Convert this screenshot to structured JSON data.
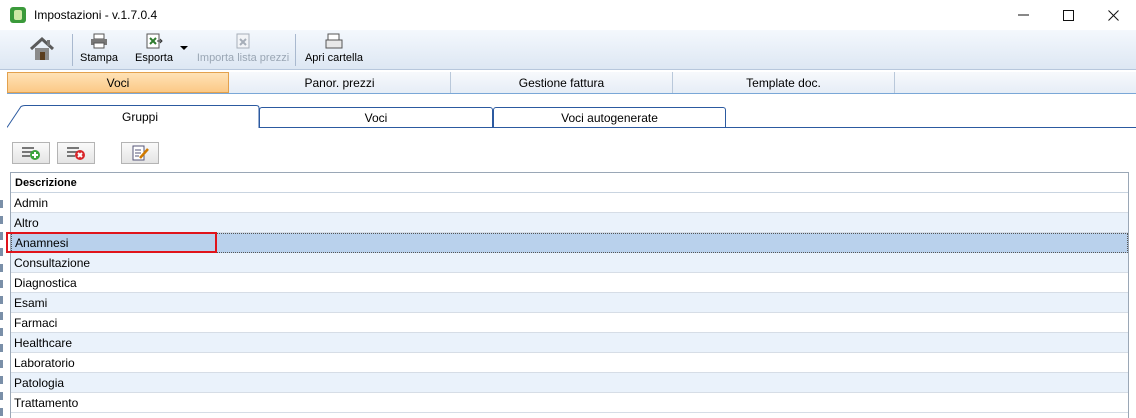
{
  "window": {
    "title": "Impostazioni  -  v.1.7.0.4",
    "controls": [
      "minimize",
      "maximize",
      "close"
    ]
  },
  "toolbar": {
    "home_icon": "home-icon",
    "stampa_label": "Stampa",
    "esporta_label": "Esporta",
    "importa_label": "Importa lista prezzi",
    "apri_label": "Apri cartella"
  },
  "main_tabs": [
    {
      "label": "Voci",
      "active": true
    },
    {
      "label": "Panor. prezzi",
      "active": false
    },
    {
      "label": "Gestione fattura",
      "active": false
    },
    {
      "label": "Template doc.",
      "active": false
    }
  ],
  "sub_tabs": [
    {
      "label": "Gruppi",
      "active": true
    },
    {
      "label": "Voci",
      "active": false
    },
    {
      "label": "Voci autogenerate",
      "active": false
    }
  ],
  "actions": [
    "add-icon",
    "delete-icon",
    "edit-icon"
  ],
  "grid": {
    "header": "Descrizione",
    "rows": [
      "Admin",
      "Altro",
      "Anamnesi",
      "Consultazione",
      "Diagnostica",
      "Esami",
      "Farmaci",
      "Healthcare",
      "Laboratorio",
      "Patologia",
      "Trattamento"
    ],
    "selected_index": 2
  },
  "colors": {
    "active_tab": "#fbc987",
    "selected_row": "#b9d1ec",
    "alt_row": "#eaf2fb",
    "highlight": "#e0141b"
  }
}
